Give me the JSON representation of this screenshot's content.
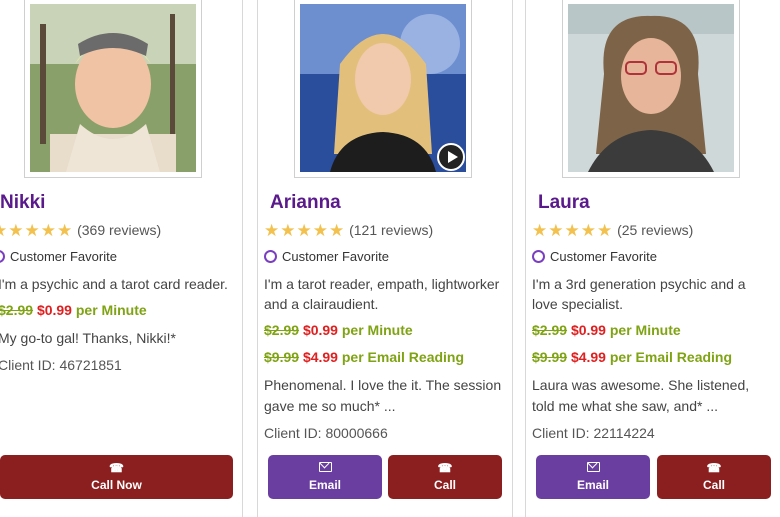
{
  "advisors": [
    {
      "name": "Nikki",
      "stars": "★★★★★",
      "reviews": "(369 reviews)",
      "badge": "Customer Favorite",
      "description": "I'm a psychic and a tarot card reader.",
      "price_minute": {
        "old": "$2.99",
        "new": "$0.99",
        "unit": "per Minute"
      },
      "review_snippet": "My go-to gal! Thanks, Nikki!*",
      "client_id": "Client ID: 46721851",
      "call_label": "Call Now"
    },
    {
      "name": "Arianna",
      "stars": "★★★★★",
      "reviews": "(121 reviews)",
      "badge": "Customer Favorite",
      "description": "I'm a tarot reader, empath, lightworker and a clairaudient.",
      "price_minute": {
        "old": "$2.99",
        "new": "$0.99",
        "unit": "per Minute"
      },
      "price_email": {
        "old": "$9.99",
        "new": "$4.99",
        "unit": "per Email Reading"
      },
      "review_snippet": "Phenomenal. I love the it. The session gave me so much* ...",
      "client_id": "Client ID: 80000666",
      "email_label": "Email",
      "call_label": "Call"
    },
    {
      "name": "Laura",
      "stars": "★★★★★",
      "reviews": "(25 reviews)",
      "badge": "Customer Favorite",
      "description": "I'm a 3rd generation psychic and a love specialist.",
      "price_minute": {
        "old": "$2.99",
        "new": "$0.99",
        "unit": "per Minute"
      },
      "price_email": {
        "old": "$9.99",
        "new": "$4.99",
        "unit": "per Email Reading"
      },
      "review_snippet": "Laura was awesome. She listened, told me what she saw, and* ...",
      "client_id": "Client ID: 22114224",
      "email_label": "Email",
      "call_label": "Call"
    }
  ],
  "icons": {
    "phone": "phone-icon",
    "email": "envelope-icon",
    "play": "play-icon",
    "star": "star-icon",
    "heart": "heart-icon"
  },
  "colors": {
    "name": "#5a1a8c",
    "call": "#8b1f1f",
    "email": "#6a3ea1",
    "old_price": "#7fa313",
    "new_price": "#e02020",
    "star": "#f2c14e"
  }
}
